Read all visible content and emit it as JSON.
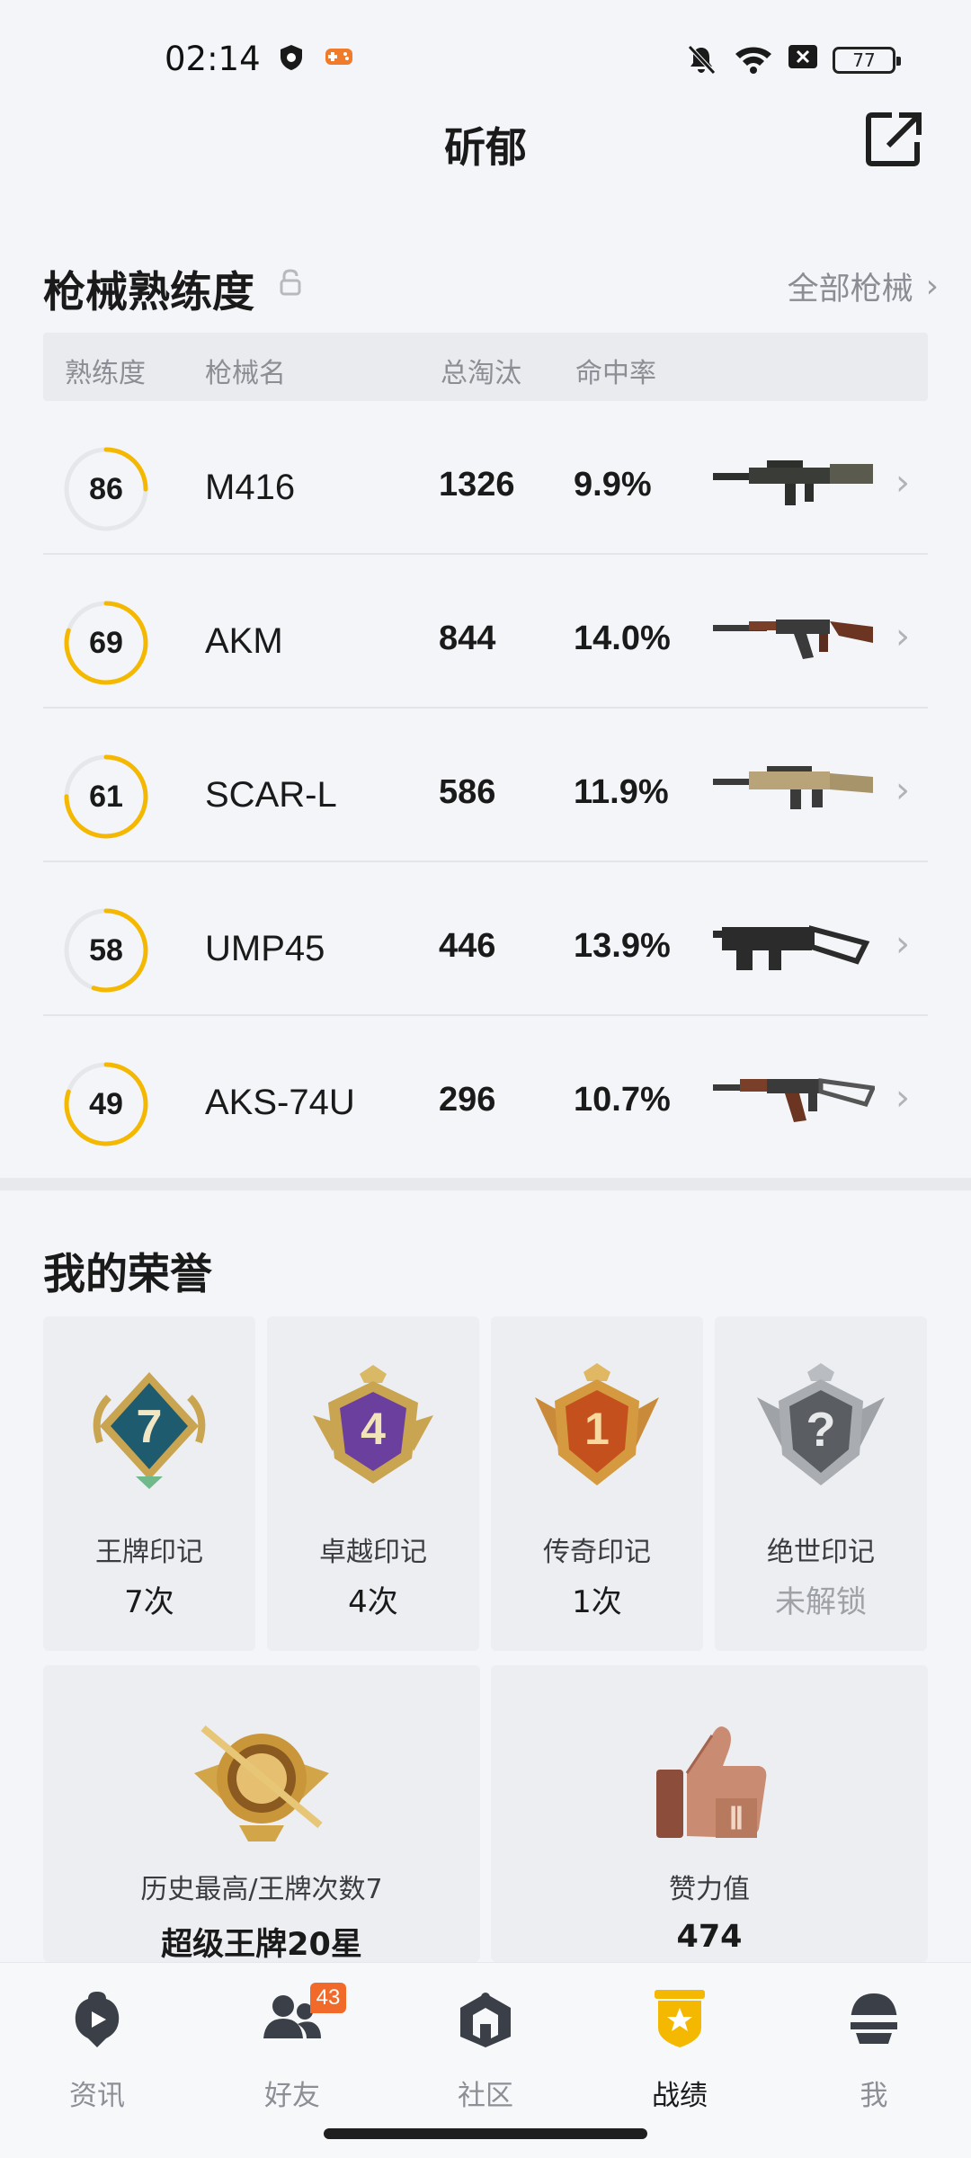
{
  "status_bar": {
    "time": "02:14",
    "battery": "77"
  },
  "header": {
    "title": "斫郁"
  },
  "weapons_section": {
    "title": "枪械熟练度",
    "all_link": "全部枪械",
    "columns": [
      "熟练度",
      "枪械名",
      "总淘汰",
      "命中率"
    ],
    "rows": [
      {
        "level": "86",
        "progress": 0.25,
        "name": "M416",
        "kills": "1326",
        "accuracy": "9.9%",
        "icon": "rifle-m416"
      },
      {
        "level": "69",
        "progress": 0.8,
        "name": "AKM",
        "kills": "844",
        "accuracy": "14.0%",
        "icon": "rifle-akm"
      },
      {
        "level": "61",
        "progress": 0.75,
        "name": "SCAR-L",
        "kills": "586",
        "accuracy": "11.9%",
        "icon": "rifle-scar-l"
      },
      {
        "level": "58",
        "progress": 0.55,
        "name": "UMP45",
        "kills": "446",
        "accuracy": "13.9%",
        "icon": "smg-ump45"
      },
      {
        "level": "49",
        "progress": 0.8,
        "name": "AKS-74U",
        "kills": "296",
        "accuracy": "10.7%",
        "icon": "rifle-aks74u"
      }
    ]
  },
  "honors_section": {
    "title": "我的荣誉",
    "badges": [
      {
        "label": "王牌印记",
        "count": "7次",
        "badge_text": "7",
        "locked": false
      },
      {
        "label": "卓越印记",
        "count": "4次",
        "badge_text": "4",
        "locked": false
      },
      {
        "label": "传奇印记",
        "count": "1次",
        "badge_text": "1",
        "locked": false
      },
      {
        "label": "绝世印记",
        "count": "未解锁",
        "badge_text": "?",
        "locked": true
      }
    ],
    "history": {
      "label": "历史最高/王牌次数7",
      "value": "超级王牌20星"
    },
    "likes": {
      "label": "赞力值",
      "value": "474"
    }
  },
  "bottom_nav": {
    "items": [
      {
        "label": "资讯",
        "icon": "news-icon"
      },
      {
        "label": "好友",
        "icon": "friends-icon",
        "badge": "43"
      },
      {
        "label": "社区",
        "icon": "community-icon"
      },
      {
        "label": "战绩",
        "icon": "record-icon",
        "active": true
      },
      {
        "label": "我",
        "icon": "profile-icon"
      }
    ]
  },
  "colors": {
    "accent": "#f5b800",
    "ring_track": "#e6e7ea",
    "nav_active": "#f5b800"
  }
}
